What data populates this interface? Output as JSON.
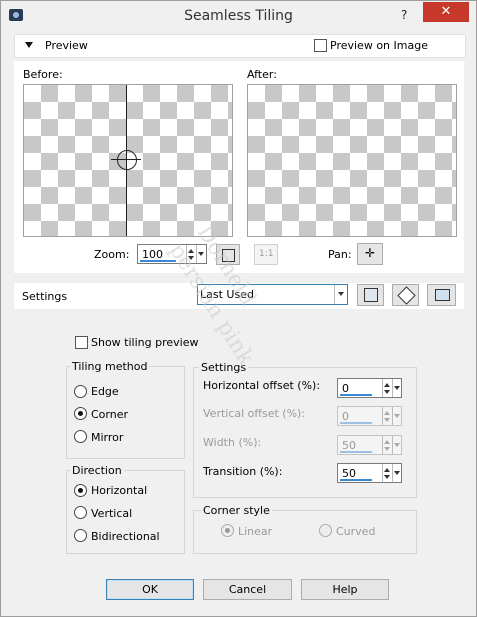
{
  "window": {
    "title": "Seamless Tiling",
    "help_symbol": "?",
    "close_symbol": "✕"
  },
  "preview_section": {
    "label": "Preview",
    "preview_on_image_label": "Preview on Image",
    "before_label": "Before:",
    "after_label": "After:",
    "zoom_label": "Zoom:",
    "zoom_value": "100",
    "ratio_label": "1:1",
    "pan_label": "Pan:"
  },
  "settings_bar": {
    "label": "Settings",
    "preset_value": "Last Used"
  },
  "show_tiling_preview_label": "Show tiling preview",
  "tiling_method": {
    "label": "Tiling method",
    "options": [
      "Edge",
      "Corner",
      "Mirror"
    ],
    "selected": "Corner"
  },
  "direction": {
    "label": "Direction",
    "options": [
      "Horizontal",
      "Vertical",
      "Bidirectional"
    ],
    "selected": "Horizontal"
  },
  "settings_group": {
    "label": "Settings",
    "horizontal_offset_label": "Horizontal offset (%):",
    "horizontal_offset_value": "0",
    "vertical_offset_label": "Vertical offset (%):",
    "vertical_offset_value": "0",
    "width_label": "Width (%):",
    "width_value": "50",
    "transition_label": "Transition (%):",
    "transition_value": "50"
  },
  "corner_style": {
    "label": "Corner style",
    "options": [
      "Linear",
      "Curved"
    ],
    "selected": "Linear"
  },
  "buttons": {
    "ok": "OK",
    "cancel": "Cancel",
    "help": "Help"
  },
  "watermark": {
    "line1": "Dorneld",
    "line2": "persian pink"
  }
}
